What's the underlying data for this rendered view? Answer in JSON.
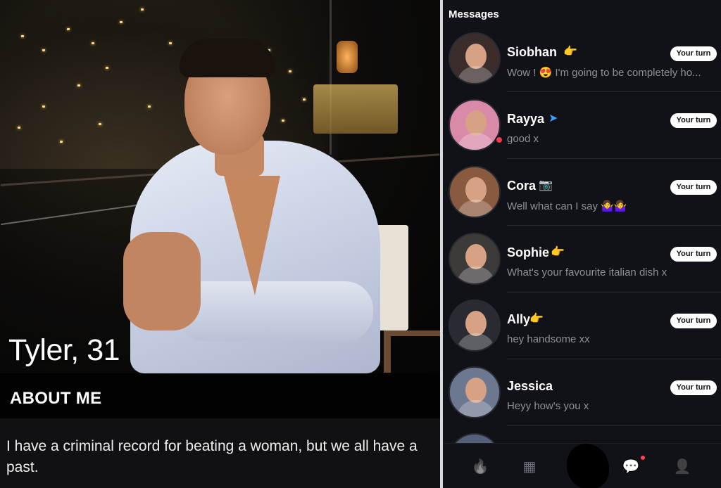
{
  "profile": {
    "name_age": "Tyler, 31",
    "about_title": "ABOUT ME",
    "about_text": "I have a criminal record for beating a woman, but we all have a past."
  },
  "messages": {
    "title": "Messages",
    "conversations": [
      {
        "name": "Siobhan",
        "badge_icon": "pointing-hand-icon",
        "badge": "👉",
        "preview": "Wow ! 😍 I'm going to be completely ho...",
        "status": "Your turn",
        "unread": false,
        "avatar_color": "#3a2d2b"
      },
      {
        "name": "Rayya",
        "badge_icon": "paper-plane-icon",
        "badge": "➤",
        "preview": "good x",
        "status": "Your turn",
        "unread": true,
        "avatar_color": "#d88aa8"
      },
      {
        "name": "Cora",
        "badge_icon": "camera-badge-icon",
        "badge": "📷",
        "preview": "Well what can I say 🤷‍♀️🤷‍♀️",
        "status": "Your turn",
        "unread": false,
        "avatar_color": "#8a5a40"
      },
      {
        "name": "Sophie",
        "badge_icon": "pointing-hand-icon",
        "badge": "👉",
        "preview": "What's your favourite italian dish x",
        "status": "Your turn",
        "unread": false,
        "avatar_color": "#3d3a3a"
      },
      {
        "name": "Ally",
        "badge_icon": "pointing-hand-icon",
        "badge": "👉",
        "preview": "hey handsome xx",
        "status": "Your turn",
        "unread": false,
        "avatar_color": "#2a2a33"
      },
      {
        "name": "Jessica",
        "badge_icon": "",
        "badge": "",
        "preview": "Heyy how's you x",
        "status": "Your turn",
        "unread": false,
        "avatar_color": "#6b7890"
      }
    ]
  },
  "tabbar": {
    "items": [
      {
        "icon": "flame-icon",
        "glyph": "🔥"
      },
      {
        "icon": "explore-icon",
        "glyph": "▦"
      },
      {
        "icon": "likes-icon",
        "glyph": "◆"
      },
      {
        "icon": "chat-icon",
        "glyph": "💬"
      },
      {
        "icon": "profile-icon",
        "glyph": "👤"
      }
    ],
    "active_color": "#ff4458"
  }
}
